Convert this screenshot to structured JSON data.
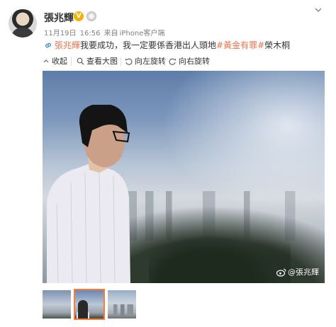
{
  "post": {
    "username": "張兆輝",
    "verified_badge": "V",
    "meta": {
      "date": "11月19日",
      "time": "16:56",
      "from_label": "来自",
      "client": "iPhone客户端"
    },
    "content": {
      "mention": "張兆輝",
      "text": "我要成功，我一定要係香港出人頭地",
      "hashtag1": "#黃金有罪#",
      "hashtag2": "榮木桐"
    },
    "toolbar": {
      "collapse_label": "收起",
      "view_large_label": "查看大图",
      "rotate_left_label": "向左旋转",
      "rotate_right_label": "向右旋转"
    },
    "watermark": "@張兆輝",
    "thumbnail_count": 3,
    "selected_thumbnail_index": 1
  },
  "icons": {
    "avatar": "avatar",
    "verified": "verified-v-badge-icon",
    "medal": "medal-icon",
    "dropdown": "chevron-down-icon",
    "link": "link-chain-icon",
    "collapse": "arrow-up-icon",
    "view_large": "magnifier-icon",
    "rotate_left": "rotate-left-icon",
    "rotate_right": "rotate-right-icon",
    "weibo": "weibo-logo-icon"
  },
  "colors": {
    "link": "#eb7350",
    "meta_text": "#808080",
    "verified_badge": "#f7b100",
    "thumb_selected_border": "#fa7d3c"
  }
}
